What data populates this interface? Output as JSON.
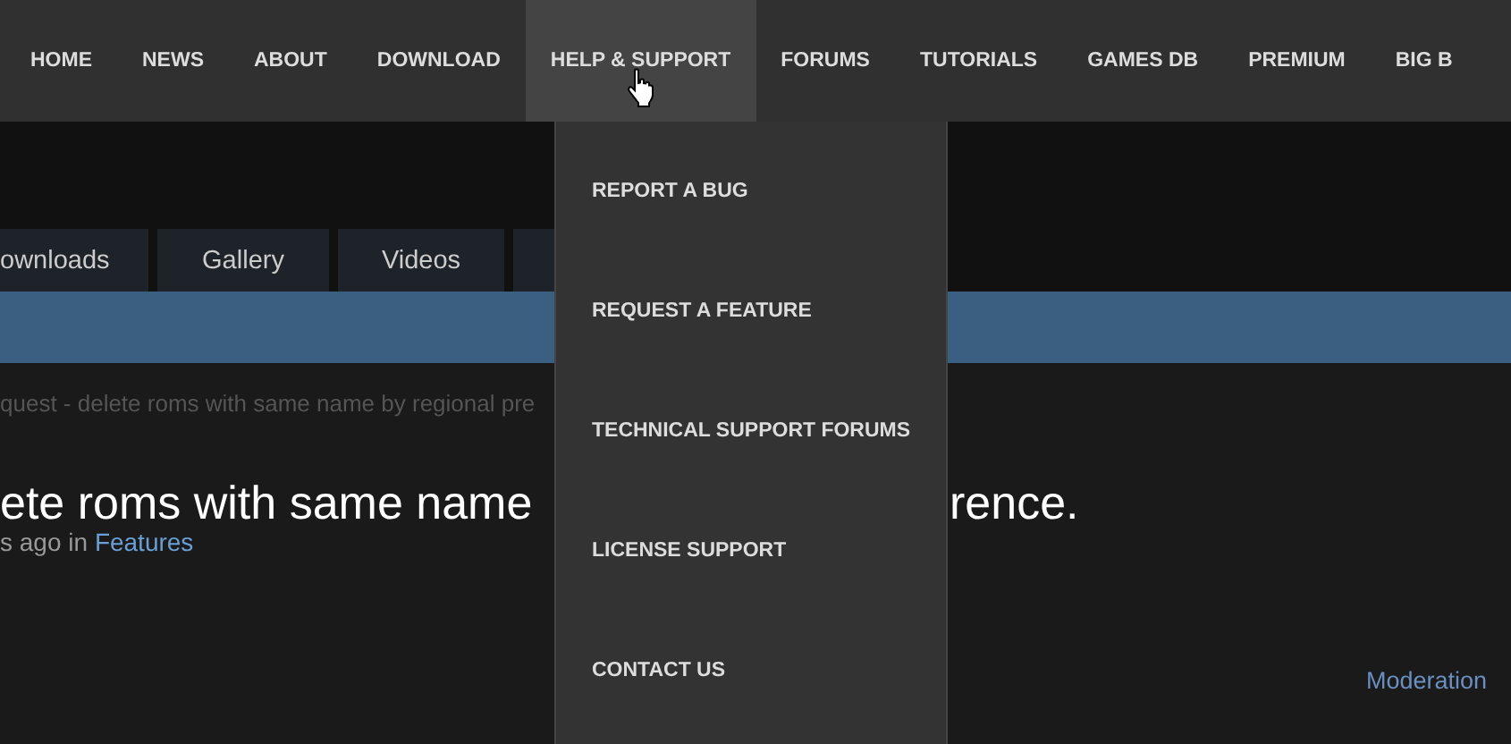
{
  "nav": [
    {
      "label": "HOME",
      "selected": false
    },
    {
      "label": "NEWS",
      "selected": false
    },
    {
      "label": "ABOUT",
      "selected": false
    },
    {
      "label": "DOWNLOAD",
      "selected": false
    },
    {
      "label": "HELP & SUPPORT",
      "selected": true
    },
    {
      "label": "FORUMS",
      "selected": false
    },
    {
      "label": "TUTORIALS",
      "selected": false
    },
    {
      "label": "GAMES DB",
      "selected": false
    },
    {
      "label": "PREMIUM",
      "selected": false
    },
    {
      "label": "BIG B",
      "selected": false
    }
  ],
  "dropdown": [
    "REPORT A BUG",
    "REQUEST A FEATURE",
    "TECHNICAL SUPPORT FORUMS",
    "LICENSE SUPPORT",
    "CONTACT US"
  ],
  "tabs": [
    {
      "label": "ownloads"
    },
    {
      "label": "Gallery"
    },
    {
      "label": "Videos"
    }
  ],
  "breadcrumb": "quest - delete roms with same name by regional pre",
  "title": {
    "left": "ete roms with same name",
    "right": "rence."
  },
  "meta": {
    "text": "s ago in",
    "link": "Features"
  },
  "moderation": "Moderation"
}
